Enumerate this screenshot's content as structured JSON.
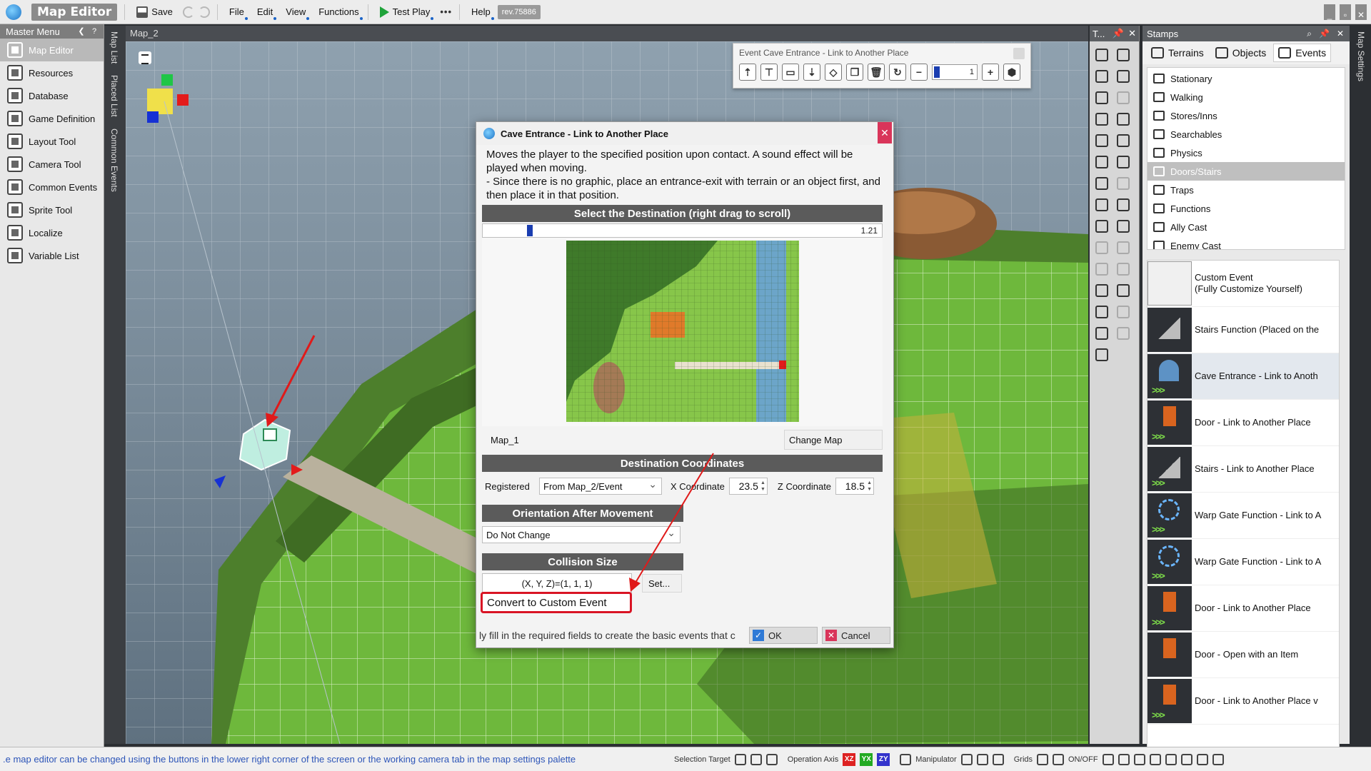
{
  "app": {
    "title": "Map Editor",
    "revision": "rev.75886"
  },
  "menubar": {
    "save": "Save",
    "items": [
      "File",
      "Edit",
      "View",
      "Functions"
    ],
    "test_play": "Test Play",
    "more": "•••",
    "help": "Help"
  },
  "master_menu": {
    "title": "Master Menu",
    "items": [
      {
        "label": "Map Editor",
        "icon": "map-editor-icon",
        "active": true
      },
      {
        "label": "Resources",
        "icon": "resources-icon"
      },
      {
        "label": "Database",
        "icon": "database-icon"
      },
      {
        "label": "Game Definition",
        "icon": "game-definition-icon"
      },
      {
        "label": "Layout Tool",
        "icon": "layout-tool-icon"
      },
      {
        "label": "Camera Tool",
        "icon": "camera-tool-icon"
      },
      {
        "label": "Common Events",
        "icon": "common-events-icon"
      },
      {
        "label": "Sprite Tool",
        "icon": "sprite-tool-icon"
      },
      {
        "label": "Localize",
        "icon": "localize-icon"
      },
      {
        "label": "Variable List",
        "icon": "variable-list-icon"
      }
    ]
  },
  "side_tabs": [
    "Map List",
    "Placed List",
    "Common Events"
  ],
  "viewport": {
    "tab": "Map_2"
  },
  "event_toolbar": {
    "title": "Event Cave Entrance - Link to Another Place",
    "layer_value": "1"
  },
  "dialog": {
    "title": "Cave Entrance - Link to Another Place",
    "description": "Moves the player to the specified position upon contact. A sound effect will be played when moving.\n- Since there is no graphic, place an entrance-exit with terrain or an object first, and then place it in that position.",
    "destination_header": "Select the Destination (right drag to scroll)",
    "zoom_value": "1.21",
    "map_name": "Map_1",
    "change_map": "Change Map",
    "coords_header": "Destination Coordinates",
    "registered_label": "Registered",
    "registered_value": "From Map_2/Event",
    "x_label": "X Coordinate",
    "x_value": "23.5",
    "z_label": "Z Coordinate",
    "z_value": "18.5",
    "orientation_header": "Orientation After Movement",
    "orientation_value": "Do Not Change",
    "collision_header": "Collision Size",
    "collision_value": "(X, Y, Z)=(1, 1, 1)",
    "set_button": "Set...",
    "convert_button": "Convert to Custom Event",
    "hint": "ly fill in the required fields to create the basic events that c",
    "ok": "OK",
    "cancel": "Cancel"
  },
  "tools_panel": {
    "title": "T..."
  },
  "stamps": {
    "title": "Stamps",
    "tabs": [
      "Terrains",
      "Objects",
      "Events"
    ],
    "active_tab": "Events",
    "categories": [
      "Stationary",
      "Walking",
      "Stores/Inns",
      "Searchables",
      "Physics",
      "Doors/Stairs",
      "Traps",
      "Functions",
      "Ally Cast",
      "Enemy Cast"
    ],
    "active_category": "Doors/Stairs",
    "items": [
      {
        "label": "Custom Event\n(Fully Customize Yourself)",
        "thumb": "custom"
      },
      {
        "label": "Stairs Function (Placed on the",
        "thumb": "stairs"
      },
      {
        "label": "Cave Entrance - Link to Anoth",
        "thumb": "cave",
        "active": true
      },
      {
        "label": "Door - Link to Another Place",
        "thumb": "door"
      },
      {
        "label": "Stairs - Link to Another Place",
        "thumb": "stairs-link"
      },
      {
        "label": "Warp Gate Function - Link to A",
        "thumb": "warp"
      },
      {
        "label": "Warp Gate Function - Link to A",
        "thumb": "warp-key"
      },
      {
        "label": "Door - Link to Another Place",
        "thumb": "door"
      },
      {
        "label": "Door - Open with an Item",
        "thumb": "door-key"
      },
      {
        "label": "Door - Link to Another Place v",
        "thumb": "door-key"
      }
    ]
  },
  "right_tab": "Map Settings",
  "statusbar": {
    "message": "e map editor can be changed using the buttons in the lower right corner of the screen or the working camera tab in the map settings palette.",
    "selection_target": "Selection Target",
    "operation_axis": "Operation Axis",
    "axes": [
      "XZ",
      "YX",
      "ZY"
    ],
    "manipulator": "Manipulator",
    "grids": "Grids",
    "onoff": "ON/OFF"
  },
  "colors": {
    "accent_red": "#d91424",
    "accent_blue": "#1a3db0",
    "grass": "#6fb83a"
  }
}
